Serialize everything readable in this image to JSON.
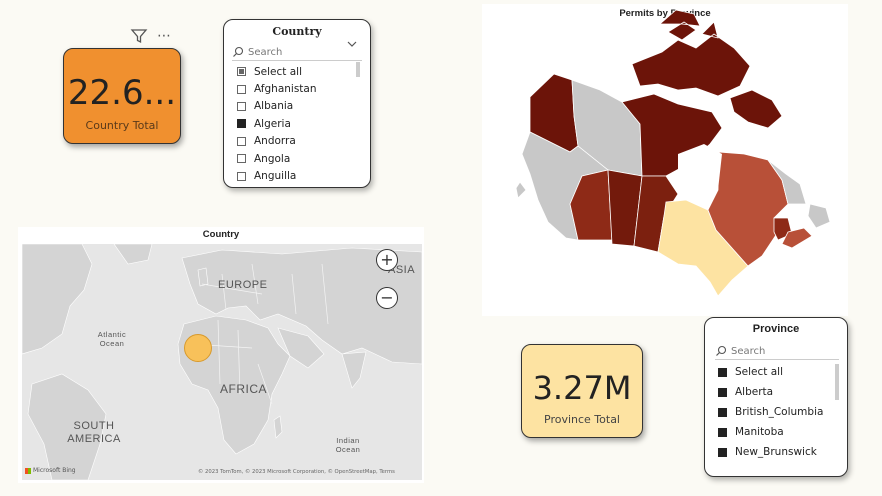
{
  "country_kpi": {
    "value": "22.6...",
    "label": "Country Total",
    "color": "#f0902f"
  },
  "country_kpi_header_icons": [
    "filter-icon",
    "more-options-icon"
  ],
  "country_slicer": {
    "title": "Country",
    "search_placeholder": "Search",
    "items": [
      {
        "label": "Select all",
        "state": "partial"
      },
      {
        "label": "Afghanistan",
        "state": "empty"
      },
      {
        "label": "Albania",
        "state": "empty"
      },
      {
        "label": "Algeria",
        "state": "checked"
      },
      {
        "label": "Andorra",
        "state": "empty"
      },
      {
        "label": "Angola",
        "state": "empty"
      },
      {
        "label": "Anguilla",
        "state": "empty"
      }
    ]
  },
  "canada_map": {
    "title": "Permits by Province"
  },
  "world_map": {
    "title": "Country",
    "labels": {
      "europe": "EUROPE",
      "asia": "ASIA",
      "africa": "AFRICA",
      "south_america": "SOUTH AMERICA",
      "atlantic": "Atlantic Ocean",
      "indian": "Indian Ocean"
    },
    "attribution": "© 2023 TomTom, © 2023 Microsoft Corporation, © OpenStreetMap, Terms",
    "bing": "Microsoft Bing",
    "bubble_color": "#f8c15a"
  },
  "province_kpi": {
    "value": "3.27M",
    "label": "Province Total",
    "color": "#fde3a2"
  },
  "province_slicer": {
    "title": "Province",
    "search_placeholder": "Search",
    "items": [
      {
        "label": "Select all",
        "state": "checked"
      },
      {
        "label": "Alberta",
        "state": "checked"
      },
      {
        "label": "British_Columbia",
        "state": "checked"
      },
      {
        "label": "Manitoba",
        "state": "checked"
      },
      {
        "label": "New_Brunswick",
        "state": "checked"
      }
    ]
  }
}
